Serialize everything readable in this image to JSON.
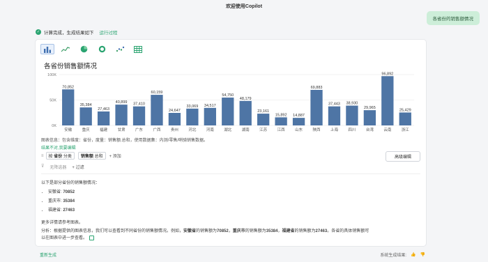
{
  "header": {
    "title": "欢迎使用Copilot"
  },
  "user_message": "各省份的销售额情况",
  "status": {
    "text": "计算完成，生成结果如下",
    "link": "运行过程"
  },
  "toolbar": {
    "items": [
      {
        "name": "bar-chart",
        "icon": "bar-chart-icon"
      },
      {
        "name": "line-chart",
        "icon": "line-chart-icon"
      },
      {
        "name": "pie-chart",
        "icon": "pie-chart-icon"
      },
      {
        "name": "donut-chart",
        "icon": "donut-chart-icon"
      },
      {
        "name": "scatter-chart",
        "icon": "scatter-chart-icon"
      },
      {
        "name": "table",
        "icon": "table-icon"
      }
    ]
  },
  "chart_data": {
    "type": "bar",
    "title": "各省份销售额情况",
    "categories": [
      "安徽",
      "重庆",
      "福建",
      "甘肃",
      "广东",
      "广西",
      "贵州",
      "河北",
      "河南",
      "湖北",
      "湖南",
      "江苏",
      "江西",
      "山东",
      "陕西",
      "上海",
      "四川",
      "台湾",
      "云南",
      "浙江"
    ],
    "values": [
      70852,
      35384,
      27463,
      40899,
      37410,
      60159,
      24647,
      33069,
      34517,
      54750,
      48179,
      23161,
      15892,
      14887,
      69883,
      37443,
      38930,
      29965,
      96892,
      25429
    ],
    "data_labels": [
      "70,852",
      "35,384",
      "27,463",
      "40,899",
      "37,410",
      "60,159",
      "24,647",
      "33,069",
      "34,517",
      "54,750",
      "48,179",
      "23,161",
      "15,892",
      "14,887",
      "69,883",
      "37,443",
      "38,930",
      "29,965",
      "96,892",
      "25,429"
    ],
    "yticks": [
      "100K",
      "50K",
      "0K"
    ],
    "ylim": [
      0,
      100000
    ],
    "color": "#4e75a5",
    "grid": true
  },
  "info": {
    "chart_info": "图表信息：包含维度：省份，度量：销售额.总和，使用数据集：内测/零售/哨骑销售数据。",
    "feedback_link": "结果不对,我要编辑",
    "pill1_prefix": "按",
    "pill1_field": "省份",
    "pill1_suffix": "分类",
    "pill2_field": "销售额",
    "pill2_suffix": "总和",
    "add": "+ 添加",
    "advanced": "高级编辑",
    "no_sort": "无降选器",
    "filter": "+ 过滤"
  },
  "summary": {
    "intro": "以下是部分省份的销售额情况：",
    "points": [
      {
        "label": "安徽省:",
        "value": "70852"
      },
      {
        "label": "重庆市:",
        "value": "35384"
      },
      {
        "label": "福建省:",
        "value": "27463"
      }
    ],
    "more": "更多详情请参考图表。",
    "analysis_1": "分析：根据提供的图表信息，我们可以查看到不同省份的销售额情况。例如，",
    "a_prov1": "安徽省",
    "a_text1": "的销售额为",
    "a_val1": "70852",
    "a_sep1": "，",
    "a_prov2": "重庆市",
    "a_text2": "的销售额为",
    "a_val2": "35384",
    "a_sep2": "，",
    "a_prov3": "福建省",
    "a_text3": "的销售额为",
    "a_val3": "27463",
    "a_tail": "。各省的具体销售额可",
    "a_line2": "以在图表中进一步查看。"
  },
  "footer": {
    "regenerate": "重新生成",
    "feedback_label": "系统生成结果:"
  }
}
